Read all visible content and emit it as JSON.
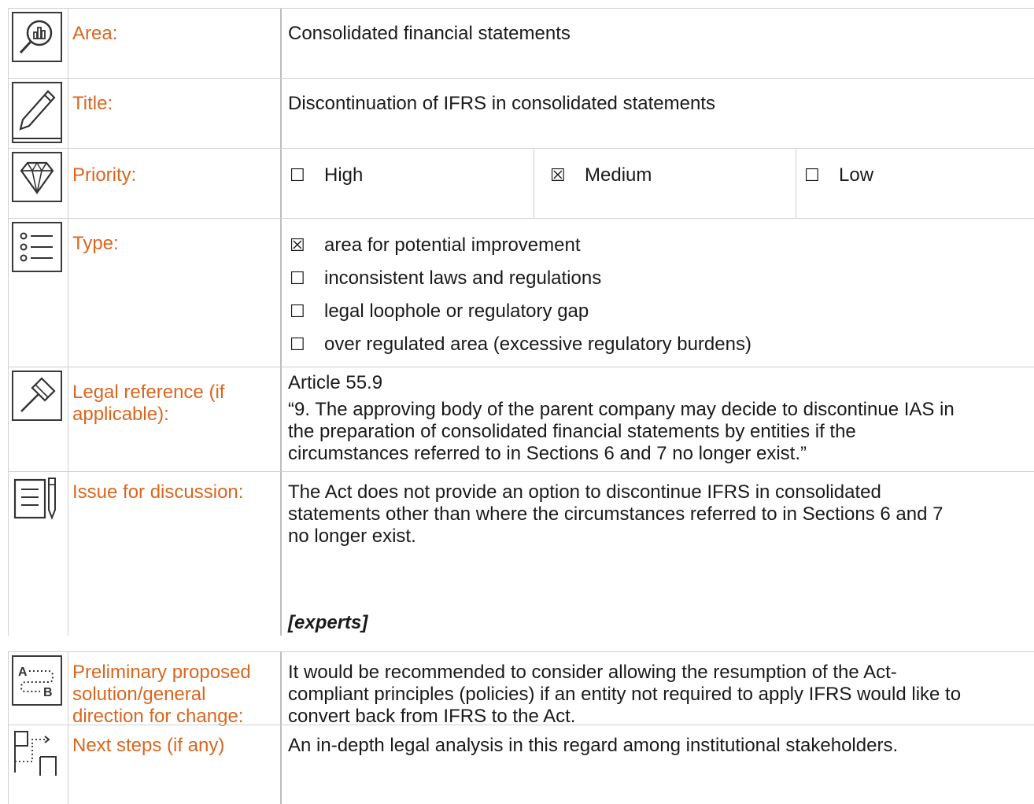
{
  "rows": {
    "area": {
      "icon": "chart-magnifier-icon",
      "label": "Area:",
      "value": "Consolidated financial statements"
    },
    "title": {
      "icon": "pencil-icon",
      "label": "Title:",
      "value": "Discontinuation of IFRS in consolidated statements"
    },
    "priority": {
      "icon": "diamond-icon",
      "label": "Priority:",
      "options": [
        {
          "box": "☐",
          "label": "High"
        },
        {
          "box": "☒",
          "label": "Medium"
        },
        {
          "box": "☐",
          "label": "Low"
        }
      ]
    },
    "type": {
      "icon": "list-icon",
      "label": "Type:",
      "options": [
        {
          "box": "☒",
          "label": "area for potential improvement"
        },
        {
          "box": "☐",
          "label": "inconsistent laws and regulations"
        },
        {
          "box": "☐",
          "label": "legal loophole or regulatory gap"
        },
        {
          "box": "☐",
          "label": "over regulated area (excessive regulatory burdens)"
        }
      ]
    },
    "legal": {
      "icon": "gavel-icon",
      "label_line1": "Legal reference (if",
      "label_line2": "applicable):",
      "article": "Article 55.9",
      "quote_line1": "“9. The approving body of the parent company may decide to discontinue IAS in",
      "quote_line2": "the preparation of consolidated financial statements by entities if the",
      "quote_line3": "circumstances referred to in Sections 6 and 7 no longer exist.”"
    },
    "issue": {
      "icon": "notepad-pen-icon",
      "label": "Issue for discussion:",
      "line1": "The Act does not provide an option to discontinue IFRS in consolidated",
      "line2": "statements other than where the circumstances referred to in Sections 6 and 7",
      "line3": "no longer exist.",
      "experts": "[experts]"
    },
    "solution": {
      "icon": "a-to-b-icon",
      "label_line1": "Preliminary proposed",
      "label_line2": "solution/general",
      "label_line3": "direction for change:",
      "line1": "It would be recommended to consider allowing the resumption of the Act-",
      "line2": "compliant principles (policies) if an entity not required to apply IFRS would like to",
      "line3": "convert back from IFRS to the Act."
    },
    "next": {
      "icon": "path-steps-icon",
      "label": "Next steps (if any)",
      "value": "An in-depth legal analysis in this regard among institutional stakeholders."
    }
  },
  "colors": {
    "label": "#d9661f",
    "text": "#1a1a1a",
    "border": "#cfcfcf"
  }
}
